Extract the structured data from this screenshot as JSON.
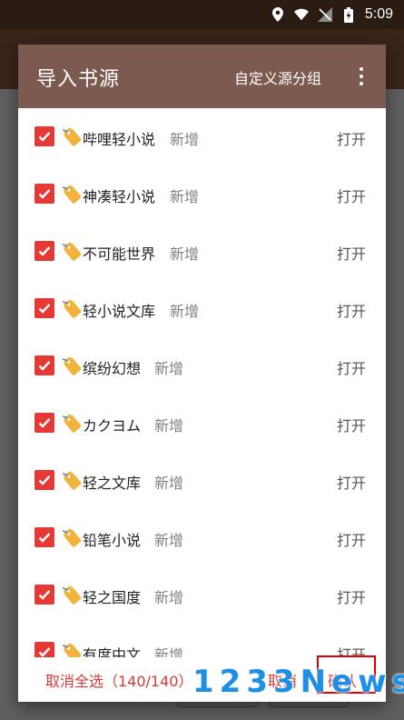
{
  "status_bar": {
    "time": "5:09"
  },
  "dialog": {
    "title": "导入书源",
    "custom_group_label": "自定义源分组",
    "items": [
      {
        "name": "哔哩轻小说",
        "status": "新增",
        "action": "打开",
        "checked": true
      },
      {
        "name": "神凑轻小说",
        "status": "新增",
        "action": "打开",
        "checked": true
      },
      {
        "name": "不可能世界",
        "status": "新增",
        "action": "打开",
        "checked": true
      },
      {
        "name": "轻小说文库",
        "status": "新增",
        "action": "打开",
        "checked": true
      },
      {
        "name": "缤纷幻想",
        "status": "新增",
        "action": "打开",
        "checked": true
      },
      {
        "name": "カクヨム",
        "status": "新增",
        "action": "打开",
        "checked": true
      },
      {
        "name": "轻之文库",
        "status": "新增",
        "action": "打开",
        "checked": true
      },
      {
        "name": "铅笔小说",
        "status": "新增",
        "action": "打开",
        "checked": true
      },
      {
        "name": "轻之国度",
        "status": "新增",
        "action": "打开",
        "checked": true
      },
      {
        "name": "有度中文",
        "status": "新增",
        "action": "打开",
        "checked": true
      }
    ],
    "footer": {
      "deselect_all": "取消全选（140/140）",
      "cancel": "取消",
      "confirm": "确认"
    }
  },
  "watermark": "1233News",
  "colors": {
    "accent": "#e53935",
    "header": "#7d5a4f",
    "footer_text": "#d73a36",
    "watermark": "#1e8fe6"
  }
}
